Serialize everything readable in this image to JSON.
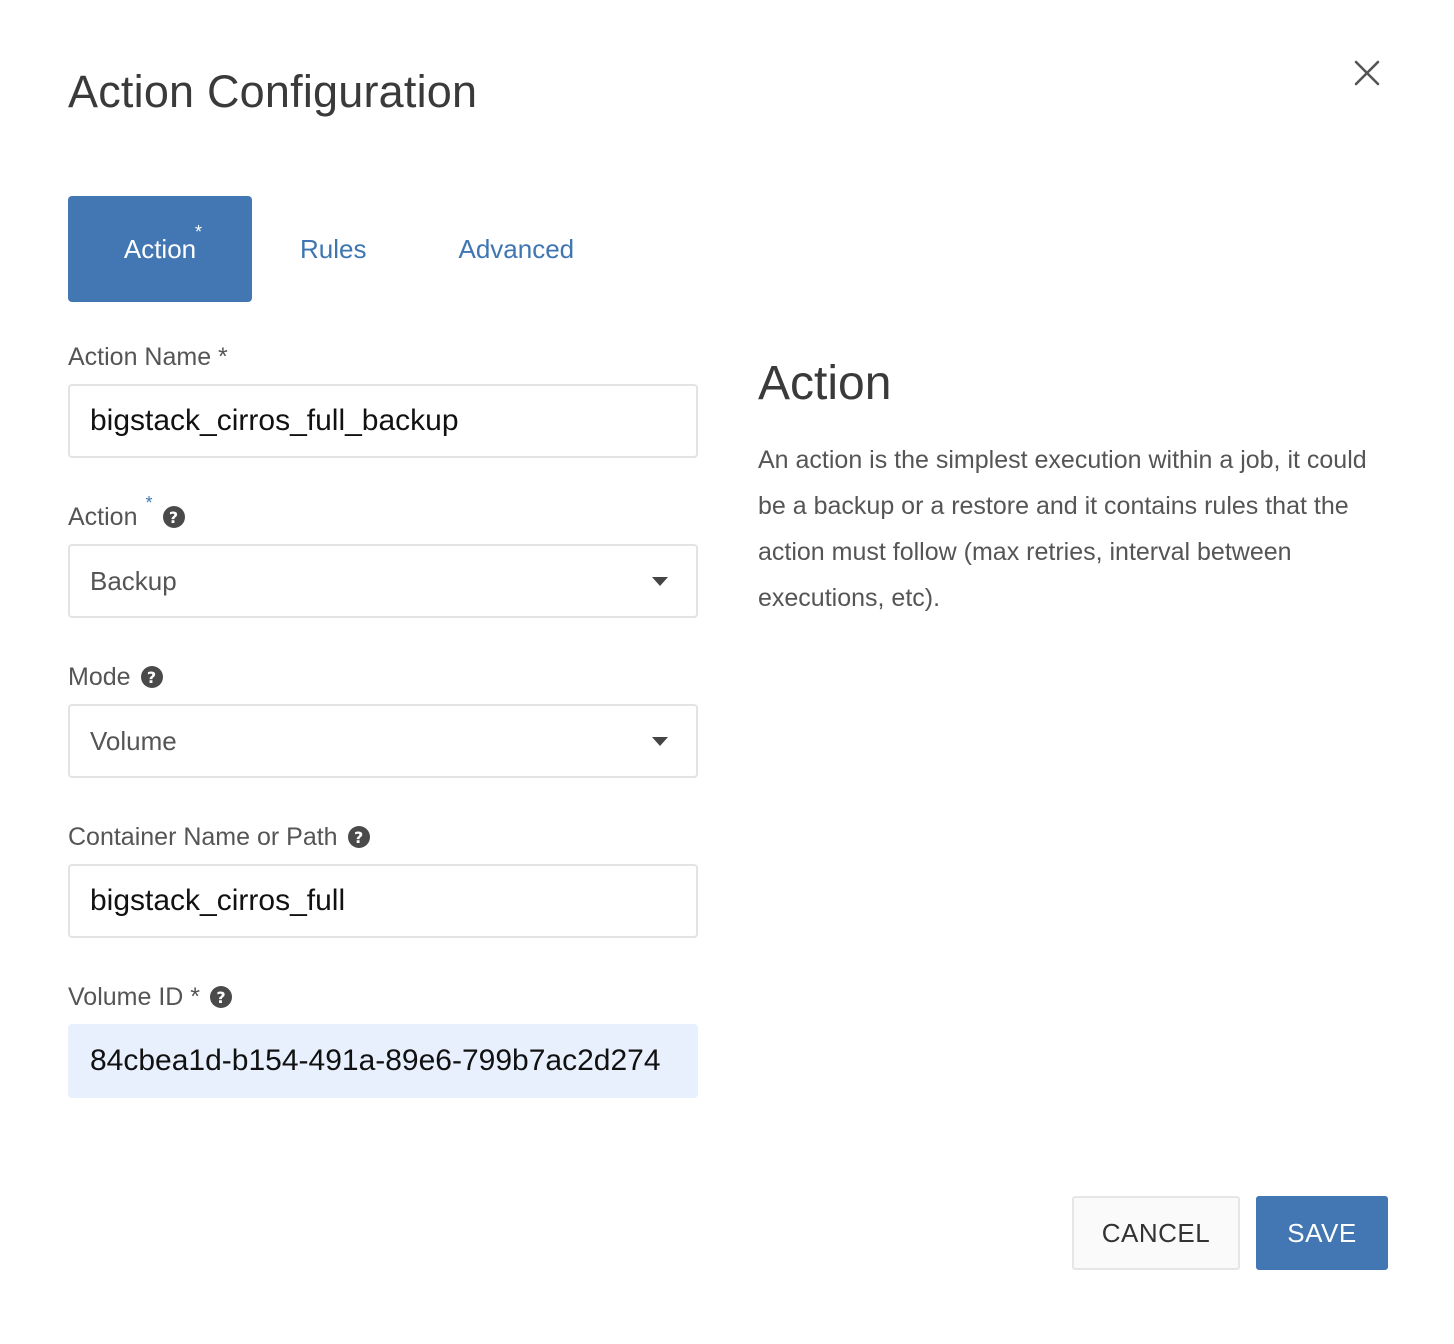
{
  "dialog": {
    "title": "Action Configuration"
  },
  "tabs": [
    {
      "label": "Action",
      "required_mark": "*",
      "active": true
    },
    {
      "label": "Rules",
      "active": false
    },
    {
      "label": "Advanced",
      "active": false
    }
  ],
  "form": {
    "action_name": {
      "label": "Action Name *",
      "value": "bigstack_cirros_full_backup"
    },
    "action": {
      "label": "Action",
      "required_mark": "*",
      "help": "?",
      "selected": "Backup"
    },
    "mode": {
      "label": "Mode",
      "help": "?",
      "selected": "Volume"
    },
    "container": {
      "label": "Container Name or Path",
      "help": "?",
      "value": "bigstack_cirros_full"
    },
    "volume_id": {
      "label": "Volume ID *",
      "help": "?",
      "value": "84cbea1d-b154-491a-89e6-799b7ac2d274"
    }
  },
  "help_panel": {
    "title": "Action",
    "text": "An action is the simplest execution within a job, it could be a backup or a restore and it contains rules that the action must follow (max retries, interval between executions, etc)."
  },
  "footer": {
    "cancel_label": "CANCEL",
    "save_label": "SAVE"
  },
  "colors": {
    "accent": "#4277b3",
    "autofill_bg": "#e8f0fe"
  }
}
